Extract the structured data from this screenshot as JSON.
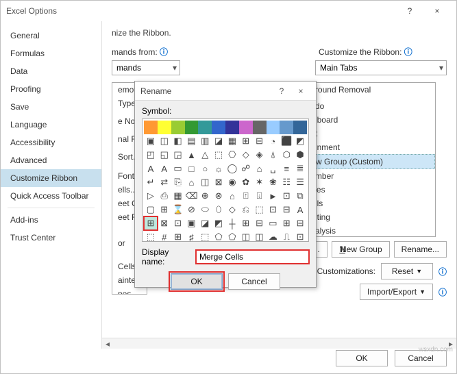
{
  "window": {
    "title": "Excel Options",
    "help_icon": "?",
    "close_icon": "×"
  },
  "sidebar": {
    "items": [
      "General",
      "Formulas",
      "Data",
      "Proofing",
      "Save",
      "Language",
      "Accessibility",
      "Advanced",
      "Customize Ribbon",
      "Quick Access Toolbar",
      "Add-ins",
      "Trust Center"
    ],
    "selected_index": 8
  },
  "content": {
    "heading_fragment": "nize the Ribbon.",
    "commands_from_label": "mands from:",
    "commands_combo": "mands",
    "left_list": [
      "emove P",
      "Types...",
      "e Now",
      "nal Form",
      "Sort...",
      "Font Siz",
      "ells...",
      "eet Colu",
      "eet Row",
      "or",
      "Cells",
      "ainter",
      "nes"
    ],
    "customize_label": "Customize the Ribbon:",
    "customize_combo": "Main Tabs",
    "right_list": [
      "ground Removal",
      "ndo",
      "ipboard",
      "nt",
      "ignment",
      "ew Group (Custom)",
      "umber",
      "yles",
      "ells",
      "diting",
      "nalysis"
    ],
    "right_selected_index": 5,
    "new_tab": "New Tab",
    "new_group": "New Group",
    "rename": "Rename...",
    "customizations_label": "Customizations:",
    "reset": "Reset",
    "import_export": "Import/Export"
  },
  "footer": {
    "ok": "OK",
    "cancel": "Cancel"
  },
  "dialog": {
    "title": "Rename",
    "symbol_label": "Symbol:",
    "display_name_label": "Display name:",
    "display_name_value": "Merge Cells",
    "ok": "OK",
    "cancel": "Cancel",
    "colors_row": [
      "#ff9933",
      "#ffff33",
      "#99cc33",
      "#339933",
      "#339999",
      "#3366cc",
      "#333399",
      "#cc66cc",
      "#666666",
      "#99ccff",
      "#6699cc",
      "#336699"
    ],
    "glyph_grid": [
      [
        "▣",
        "◫",
        "◧",
        "▤",
        "▥",
        "◪",
        "▦",
        "⊞",
        "⊟",
        "◔",
        "⬛",
        "◩"
      ],
      [
        "◰",
        "◱",
        "◲",
        "▲",
        "△",
        "⬚",
        "⎔",
        "◇",
        "◈",
        "⍋",
        "⬡",
        "⬢"
      ],
      [
        "A",
        "A",
        "▭",
        "□",
        "○",
        "☼",
        "◯",
        "☍",
        "⌂",
        "␣",
        "≡",
        "≣"
      ],
      [
        "↵",
        "⇄",
        "⎘",
        "⌂",
        "◫",
        "⊠",
        "◉",
        "✿",
        "✶",
        "❀",
        "☷",
        "☰"
      ],
      [
        "▷",
        "⎙",
        "▦",
        "⌫",
        "⊕",
        "⊗",
        "⌂",
        "⍐",
        "⍗",
        "►",
        "⊡",
        "⧉"
      ],
      [
        "▢",
        "⊞",
        "⌛",
        "⊘",
        "⬭",
        "⬯",
        "◇",
        "⎌",
        "⬚",
        "⊡",
        "⊟",
        "A"
      ],
      [
        "⊞",
        "⊠",
        "⊡",
        "▣",
        "◪",
        "◩",
        "┼",
        "⊞",
        "⊟",
        "▭",
        "⊞",
        "⊟"
      ],
      [
        "⬚",
        "#",
        "⊞",
        "♯",
        "⬚",
        "⬠",
        "⬠",
        "◫",
        "◫",
        "☁",
        "⎍",
        "⊡"
      ]
    ],
    "selected_cell": [
      6,
      0
    ]
  },
  "watermark": "wsxdn.com"
}
